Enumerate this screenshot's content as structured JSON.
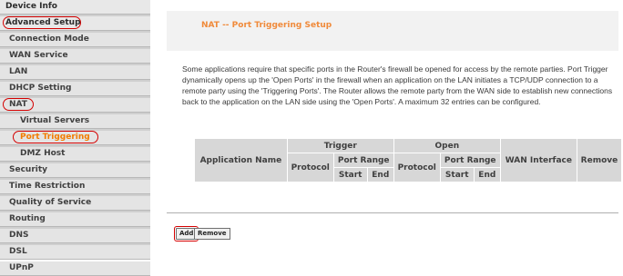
{
  "sidebar": {
    "items": [
      {
        "label": "Device Info"
      },
      {
        "label": "Advanced Setup"
      },
      {
        "label": "Connection Mode"
      },
      {
        "label": "WAN Service"
      },
      {
        "label": "LAN"
      },
      {
        "label": "DHCP Setting"
      },
      {
        "label": "NAT"
      },
      {
        "label": "Virtual Servers"
      },
      {
        "label": "Port Triggering"
      },
      {
        "label": "DMZ Host"
      },
      {
        "label": "Security"
      },
      {
        "label": "Time Restriction"
      },
      {
        "label": "Quality of Service"
      },
      {
        "label": "Routing"
      },
      {
        "label": "DNS"
      },
      {
        "label": "DSL"
      },
      {
        "label": "UPnP"
      }
    ],
    "selected": "Port Triggering"
  },
  "main": {
    "title": "NAT -- Port Triggering Setup",
    "description": "Some applications require that specific ports in the Router's firewall be opened for access by the remote parties. Port Trigger dynamically opens up the 'Open Ports' in the firewall when an application on the LAN initiates a TCP/UDP connection to a remote party using the 'Triggering Ports'. The Router allows the remote party from the WAN side to establish new connections back to the application on the LAN side using the 'Open Ports'. A maximum 32 entries can be configured.",
    "table": {
      "application_name": "Application Name",
      "trigger": "Trigger",
      "open": "Open",
      "protocol": "Protocol",
      "port_range": "Port Range",
      "start": "Start",
      "end": "End",
      "wan_interface": "WAN Interface",
      "remove": "Remove"
    },
    "buttons": {
      "add": "Add",
      "remove": "Remove"
    }
  },
  "colors": {
    "accent_orange": "#f08a3a",
    "annotation_red": "#d40000",
    "nav_background": "#cfcfcf",
    "table_header": "#d7d7d7"
  }
}
